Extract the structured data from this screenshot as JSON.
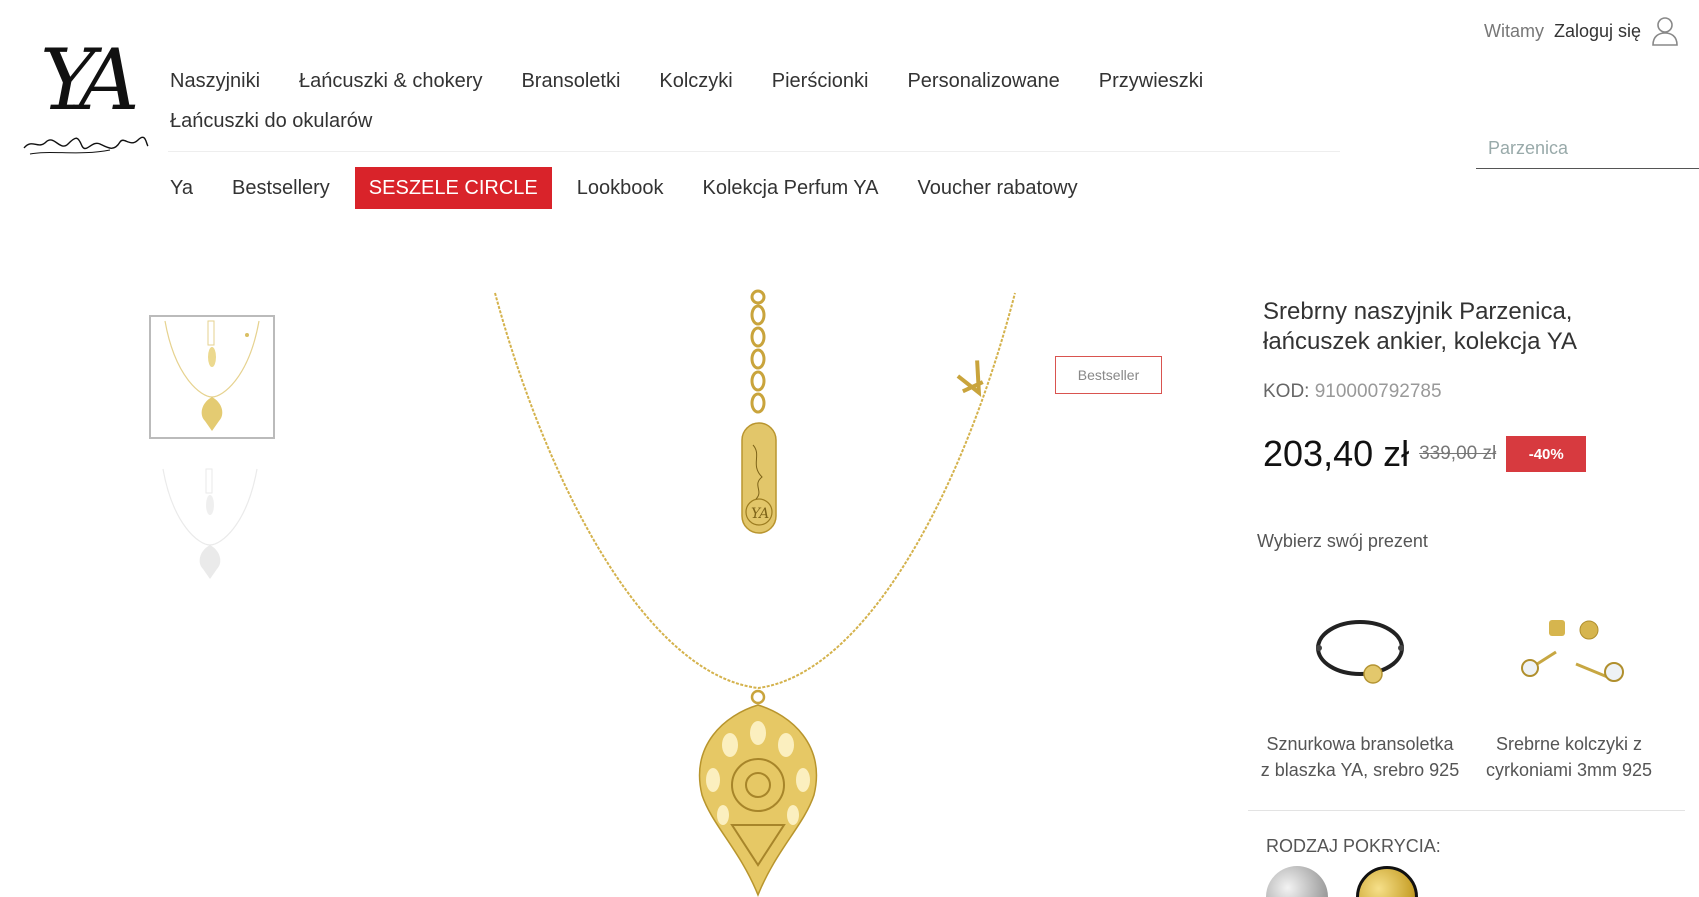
{
  "brand": {
    "logo_text": "YA"
  },
  "account": {
    "greeting": "Witamy",
    "login_label": "Zaloguj się"
  },
  "main_nav": [
    "Naszyjniki",
    "Łańcuszki & chokery",
    "Bransoletki",
    "Kolczyki",
    "Pierścionki",
    "Personalizowane",
    "Przywieszki",
    "Łańcuszki do okularów"
  ],
  "search": {
    "placeholder": "Parzenica"
  },
  "sub_nav": [
    {
      "label": "Ya",
      "active": false
    },
    {
      "label": "Bestsellery",
      "active": false
    },
    {
      "label": "SESZELE CIRCLE",
      "active": true
    },
    {
      "label": "Lookbook",
      "active": false
    },
    {
      "label": "Kolekcja Perfum YA",
      "active": false
    },
    {
      "label": "Voucher rabatowy",
      "active": false
    }
  ],
  "product": {
    "badge": "Bestseller",
    "title": "Srebrny naszyjnik Parzenica, łańcuszek ankier, kolekcja YA",
    "code_label": "KOD:",
    "code": "910000792785",
    "price": "203,40 zł",
    "old_price": "339,00 zł",
    "discount": "-40%"
  },
  "gift": {
    "heading": "Wybierz swój prezent",
    "items": [
      {
        "name": "Sznurkowa bransoletka z blaszka YA, srebro 925"
      },
      {
        "name": "Srebrne kolczyki z cyrkoniami 3mm 925"
      }
    ]
  },
  "coating": {
    "label": "RODZAJ POKRYCIA:",
    "options": [
      "silver",
      "gold"
    ],
    "selected": "gold"
  },
  "colors": {
    "accent_red": "#d9232a",
    "gold": "#d4b24c",
    "discount_red": "#d73a3f"
  },
  "icons": [
    "user-icon",
    "necklace-image",
    "bracelet-image",
    "earrings-image"
  ]
}
